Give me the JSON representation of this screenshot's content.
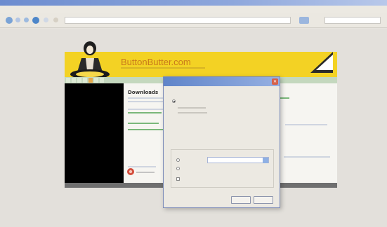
{
  "window": {
    "title": ""
  },
  "menubar": {
    "items": [
      "",
      "",
      "",
      "",
      "",
      "",
      ""
    ]
  },
  "navbar": {
    "url": ""
  },
  "page": {
    "toplinks": "",
    "brand": "ButtonButter.com",
    "tabs": [
      "",
      "",
      "",
      "",
      "",
      "",
      ""
    ],
    "heading": "Downloads",
    "footer": ""
  },
  "dialog": {
    "title": "",
    "close_glyph": "✕",
    "intro": "",
    "option1": "",
    "option2": "",
    "group_label": "",
    "select_value": "",
    "check1": "",
    "check2": "",
    "ok_label": "",
    "cancel_label": ""
  },
  "colors": {
    "header_yellow": "#f3d224",
    "brand_orange": "#c9781b",
    "titlebar_blue": "#6c8ccf"
  }
}
